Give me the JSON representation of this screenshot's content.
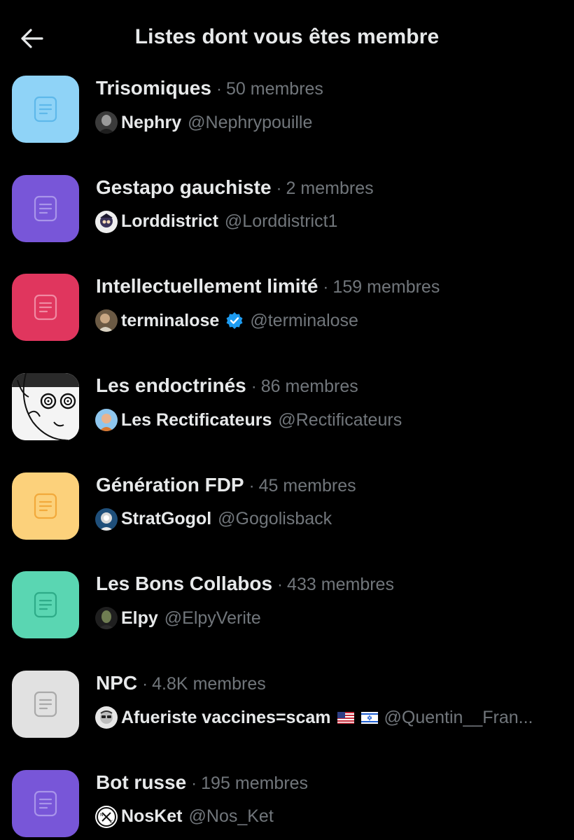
{
  "header": {
    "title": "Listes dont vous êtes membre",
    "back_icon": "arrow-left-icon"
  },
  "members_word": "membres",
  "lists": [
    {
      "name": "Trisomiques",
      "count": "50",
      "icon_color": "#8fd3f7",
      "icon_line": "#5eb8ea",
      "owner": "Nephry",
      "handle": "@Nephrypouille",
      "avatar": "nephry"
    },
    {
      "name": "Gestapo gauchiste",
      "count": "2",
      "icon_color": "#7856d8",
      "icon_line": "#a995ea",
      "owner": "Lorddistrict",
      "handle": "@Lorddistrict1",
      "avatar": "lorddistrict"
    },
    {
      "name": "Intellectuellement limité",
      "count": "159",
      "icon_color": "#e0365e",
      "icon_line": "#f08aa3",
      "owner": "terminalose",
      "handle": "@terminalose",
      "avatar": "terminalose",
      "verified": true
    },
    {
      "name": "Les endoctrinés",
      "count": "86",
      "icon_color": "#ffffff",
      "icon_line": "#000000",
      "owner": "Les Rectificateurs",
      "handle": "@Rectificateurs",
      "avatar": "rectificateurs",
      "custom_image": true
    },
    {
      "name": "Génération FDP",
      "count": "45",
      "icon_color": "#fcd17b",
      "icon_line": "#f2a93b",
      "owner": "StratGogol",
      "handle": "@Gogolisback",
      "avatar": "stratgogol"
    },
    {
      "name": "Les Bons Collabos",
      "count": "433",
      "icon_color": "#5ad6b2",
      "icon_line": "#2eab88",
      "owner": "Elpy",
      "handle": "@ElpyVerite",
      "avatar": "elpy"
    },
    {
      "name": "NPC",
      "count": "4.8K",
      "icon_color": "#e1e1e1",
      "icon_line": "#a9a9a9",
      "owner": "Afueriste vaccines=scam",
      "handle": "@Quentin__Fran...",
      "avatar": "afueriste",
      "flags": [
        "us-flag-icon",
        "israel-flag-icon"
      ]
    },
    {
      "name": "Bot russe",
      "count": "195",
      "icon_color": "#7856d8",
      "icon_line": "#a995ea",
      "owner": "NosKet",
      "handle": "@Nos_Ket",
      "avatar": "nosket"
    }
  ]
}
